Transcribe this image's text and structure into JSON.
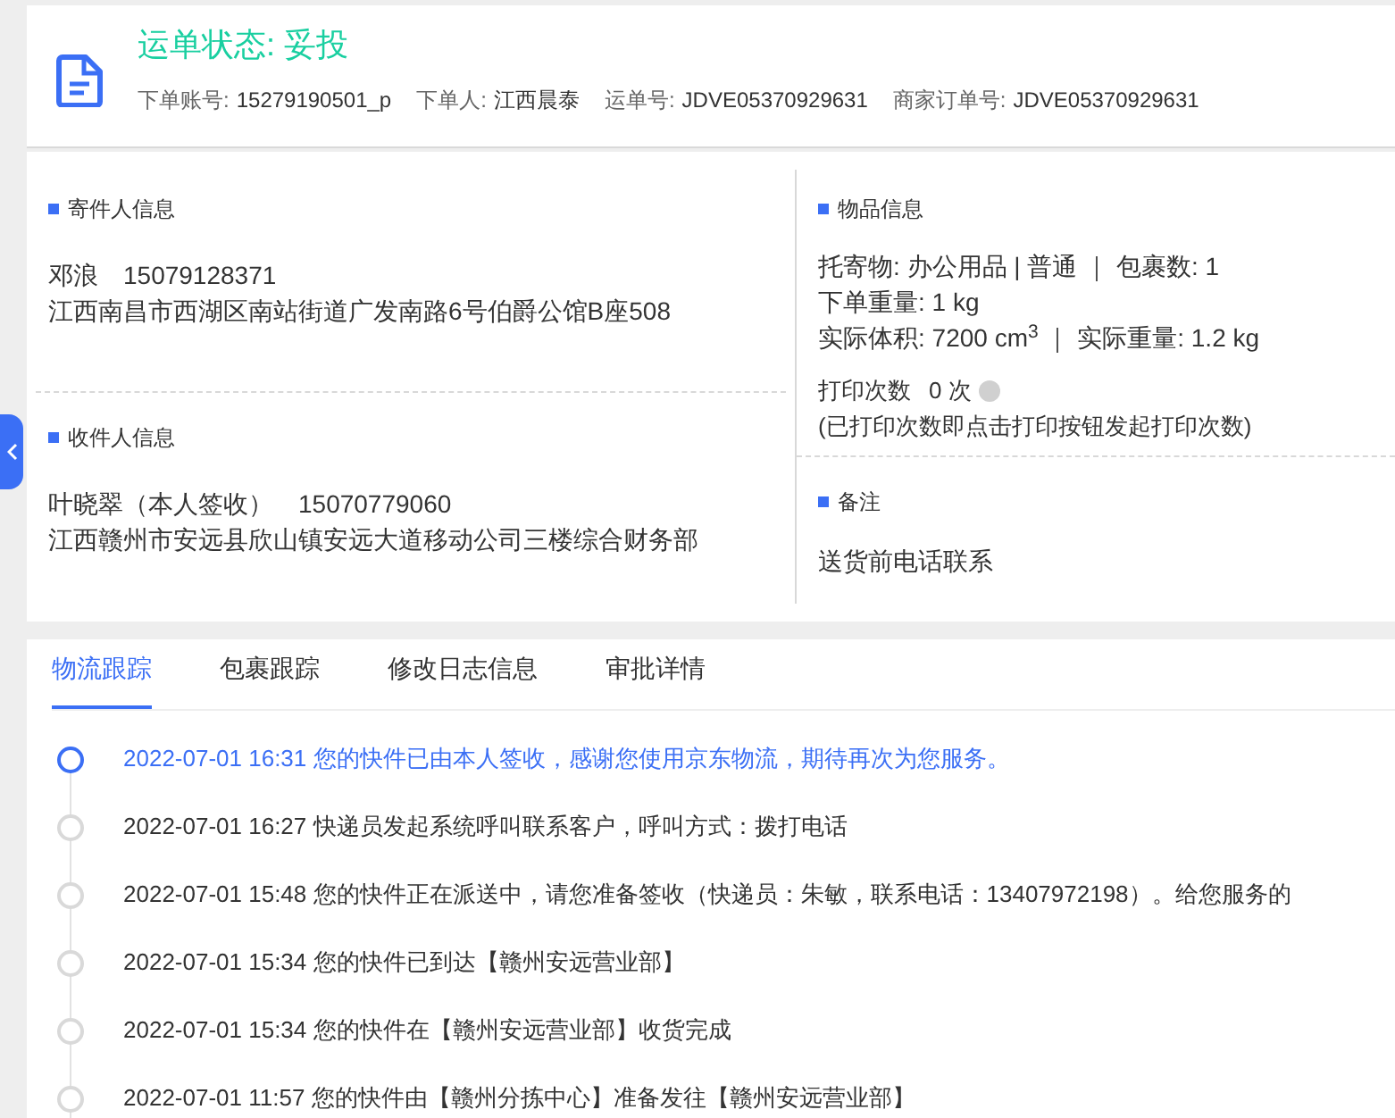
{
  "header": {
    "title": "运单状态: 妥投",
    "meta": [
      {
        "label": "下单账号:",
        "value": "15279190501_p"
      },
      {
        "label": "下单人:",
        "value": "江西晨泰"
      },
      {
        "label": "运单号:",
        "value": "JDVE05370929631"
      },
      {
        "label": "商家订单号:",
        "value": "JDVE05370929631"
      }
    ]
  },
  "sender": {
    "title": "寄件人信息",
    "name": "邓浪",
    "phone": "15079128371",
    "address": "江西南昌市西湖区南站街道广发南路6号伯爵公馆B座508"
  },
  "receiver": {
    "title": "收件人信息",
    "name": "叶晓翠（本人签收）",
    "phone": "15070779060",
    "address": "江西赣州市安远县欣山镇安远大道移动公司三楼综合财务部"
  },
  "goods": {
    "title": "物品信息",
    "lines": [
      "托寄物:  办公用品 | 普通 ｜ 包裹数:  1",
      "下单重量:  1 kg",
      "实际体积:   7200 cm$^{3}$ ｜ 实际重量:  1.2 kg"
    ],
    "print_label": "打印次数",
    "print_count": "0 次",
    "print_note": "(已打印次数即点击打印按钮发起打印次数)"
  },
  "remark": {
    "title": "备注",
    "text": "送货前电话联系"
  },
  "tabs": [
    {
      "label": "物流跟踪",
      "selected": true
    },
    {
      "label": "包裹跟踪",
      "selected": false
    },
    {
      "label": "修改日志信息",
      "selected": false
    },
    {
      "label": "审批详情",
      "selected": false
    }
  ],
  "timeline": [
    {
      "text": "2022-07-01 16:31 您的快件已由本人签收，感谢您使用京东物流，期待再次为您服务。",
      "current": true
    },
    {
      "text": "2022-07-01 16:27 快递员发起系统呼叫联系客户，呼叫方式：拨打电话",
      "current": false
    },
    {
      "text": "2022-07-01 15:48 您的快件正在派送中，请您准备签收（快递员：朱敏，联系电话：13407972198）。给您服务的",
      "current": false
    },
    {
      "text": "2022-07-01 15:34 您的快件已到达【赣州安远营业部】",
      "current": false
    },
    {
      "text": "2022-07-01 15:34 您的快件在【赣州安远营业部】收货完成",
      "current": false
    },
    {
      "text": "2022-07-01 11:57 您的快件由【赣州分拣中心】准备发往【赣州安远营业部】",
      "current": false
    }
  ]
}
